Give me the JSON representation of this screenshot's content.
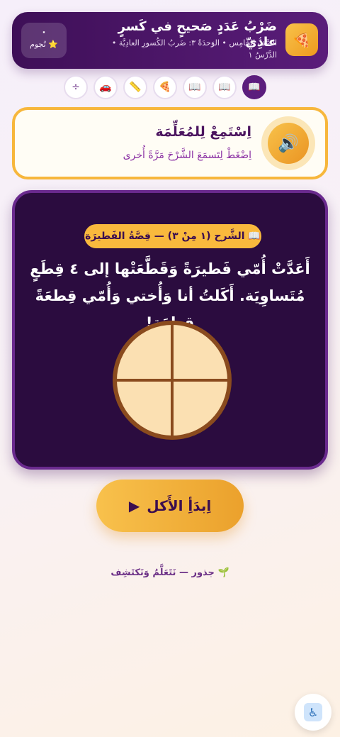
{
  "header": {
    "title": "ضَرْبُ عَدَدٍ صَحيحٍ في كَسرٍ عادِيّ",
    "subtitle": "الصَّفُّ الخامِس • الوَحدَةُ ٣: ضَربُ الكُسورِ العادِيَّة • الدَّرْسُ ١",
    "logo_icon": "🍕",
    "stars_count": "٠",
    "stars_label": "⭐ نُجوم"
  },
  "nav": {
    "items": [
      {
        "icon": "📖",
        "active": true
      },
      {
        "icon": "📖",
        "active": false
      },
      {
        "icon": "📖",
        "active": false
      },
      {
        "icon": "🍕",
        "active": false
      },
      {
        "icon": "📏",
        "active": false
      },
      {
        "icon": "🚗",
        "active": false
      },
      {
        "icon": "÷",
        "active": false
      }
    ]
  },
  "listen": {
    "title": "اِسْتَمِعْ لِلمُعَلِّمَة",
    "subtitle": "اِضْغَطْ لِتَسمَعَ الشَّرْحَ مَرَّةً أُخرى",
    "icon": "🔊"
  },
  "card": {
    "pill": "📖 الشَّرح (١ مِنْ ٣) — قِصَّةُ الفَطيرَة",
    "story": "أَعَدَّتْ أُمّي فَطيرَةً وَقَطَّعَتْها إلى ٤ قِطَعٍ مُتَساوِيَة. أَكَلتُ أنا وَأُختي وَأُمّي قِطعَةً قِطعَة!",
    "pie_pieces": 4
  },
  "start_button": {
    "label": "اِبدَأِ الأَكل",
    "icon": "▶"
  },
  "footer": "🌱 جذور — نَتَعَلَّمُ وَنَكتَشِف",
  "accessibility_icon": "♿",
  "colors": {
    "primary": "#4b145f",
    "accent": "#f7b73c",
    "card_bg": "#2b0c3f",
    "pie_fill": "#fbe0b2",
    "pie_crust": "#8a4b1e"
  }
}
